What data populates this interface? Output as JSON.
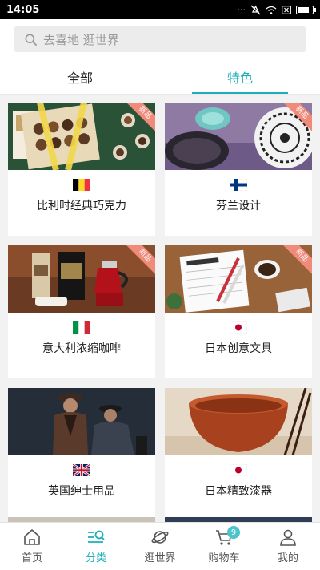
{
  "status_bar": {
    "time": "14:05",
    "icons": [
      "signal-icon",
      "mute-icon",
      "wifi-icon",
      "sim-icon",
      "battery-icon"
    ],
    "battery_level": 0.85
  },
  "search": {
    "placeholder": "去喜地  逛世界"
  },
  "tabs": [
    {
      "label": "全部",
      "active": false
    },
    {
      "label": "特色",
      "active": true
    }
  ],
  "accent_color": "#1db0b8",
  "ribbon_label": "新品",
  "cards": [
    {
      "title": "比利时经典巧克力",
      "flag": "belgium-flag",
      "new": true
    },
    {
      "title": "芬兰设计",
      "flag": "finland-flag",
      "new": true
    },
    {
      "title": "意大利浓缩咖啡",
      "flag": "italy-flag",
      "new": true
    },
    {
      "title": "日本创意文具",
      "flag": "japan-flag",
      "new": true
    },
    {
      "title": "英国绅士用品",
      "flag": "uk-flag",
      "new": false
    },
    {
      "title": "日本精致漆器",
      "flag": "japan-flag",
      "new": false
    }
  ],
  "bottom_nav": [
    {
      "label": "首页",
      "icon": "home-icon",
      "active": false
    },
    {
      "label": "分类",
      "icon": "category-icon",
      "active": true
    },
    {
      "label": "逛世界",
      "icon": "planet-icon",
      "active": false
    },
    {
      "label": "购物车",
      "icon": "cart-icon",
      "active": false,
      "badge": "9"
    },
    {
      "label": "我的",
      "icon": "user-icon",
      "active": false
    }
  ]
}
